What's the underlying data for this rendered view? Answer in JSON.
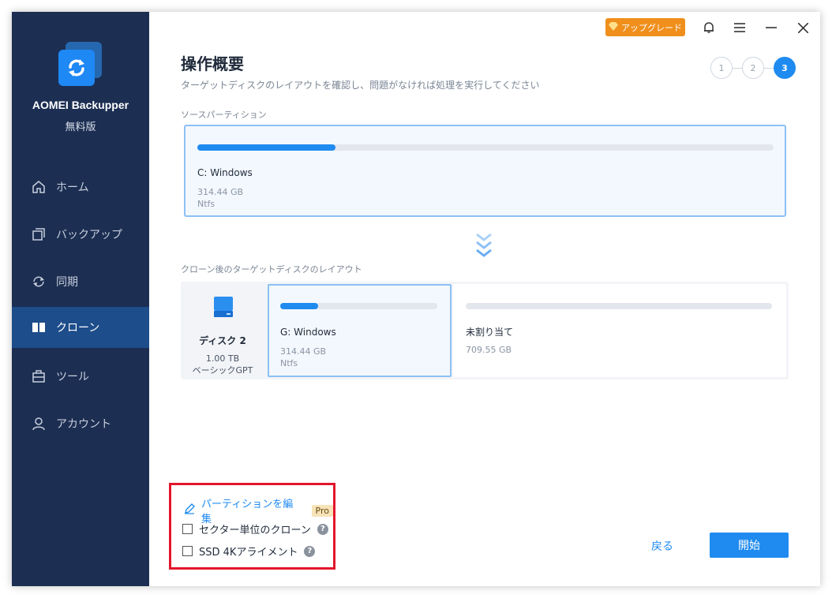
{
  "app": {
    "name": "AOMEI Backupper",
    "edition": "無料版"
  },
  "titlebar": {
    "upgrade_label": "アップグレード"
  },
  "nav": [
    {
      "label": "ホーム",
      "icon": "home-icon"
    },
    {
      "label": "バックアップ",
      "icon": "backup-icon"
    },
    {
      "label": "同期",
      "icon": "sync-icon"
    },
    {
      "label": "クローン",
      "icon": "clone-icon",
      "active": true
    },
    {
      "label": "ツール",
      "icon": "tools-icon"
    },
    {
      "label": "アカウント",
      "icon": "account-icon"
    }
  ],
  "header": {
    "title": "操作概要",
    "subtitle": "ターゲットディスクのレイアウトを確認し、問題がなければ処理を実行してください"
  },
  "steps": [
    "1",
    "2",
    "3"
  ],
  "active_step": 3,
  "source": {
    "label": "ソースパーティション",
    "partition": {
      "name": "C: Windows",
      "size": "314.44 GB",
      "fs": "Ntfs",
      "used_fraction": 0.24
    }
  },
  "target": {
    "label": "クローン後のターゲットディスクのレイアウト",
    "disk": {
      "name": "ディスク 2",
      "size": "1.00 TB",
      "type": "ベーシックGPT"
    },
    "partitions": [
      {
        "name": "G: Windows",
        "size": "314.44 GB",
        "fs": "Ntfs",
        "used_fraction": 0.24
      },
      {
        "name": "未割り当て",
        "size": "709.55 GB",
        "used_fraction": 0
      }
    ]
  },
  "options": {
    "edit_label": "パーティションを編集",
    "pro_badge": "Pro",
    "sector_clone": "セクター単位のクローン",
    "ssd_align": "SSD 4Kアライメント"
  },
  "footer": {
    "back_label": "戻る",
    "start_label": "開始"
  },
  "colors": {
    "accent": "#1f8bf0",
    "sidebar": "#1c2e52",
    "upgrade": "#f08f1c",
    "highlight": "#e3162b"
  }
}
